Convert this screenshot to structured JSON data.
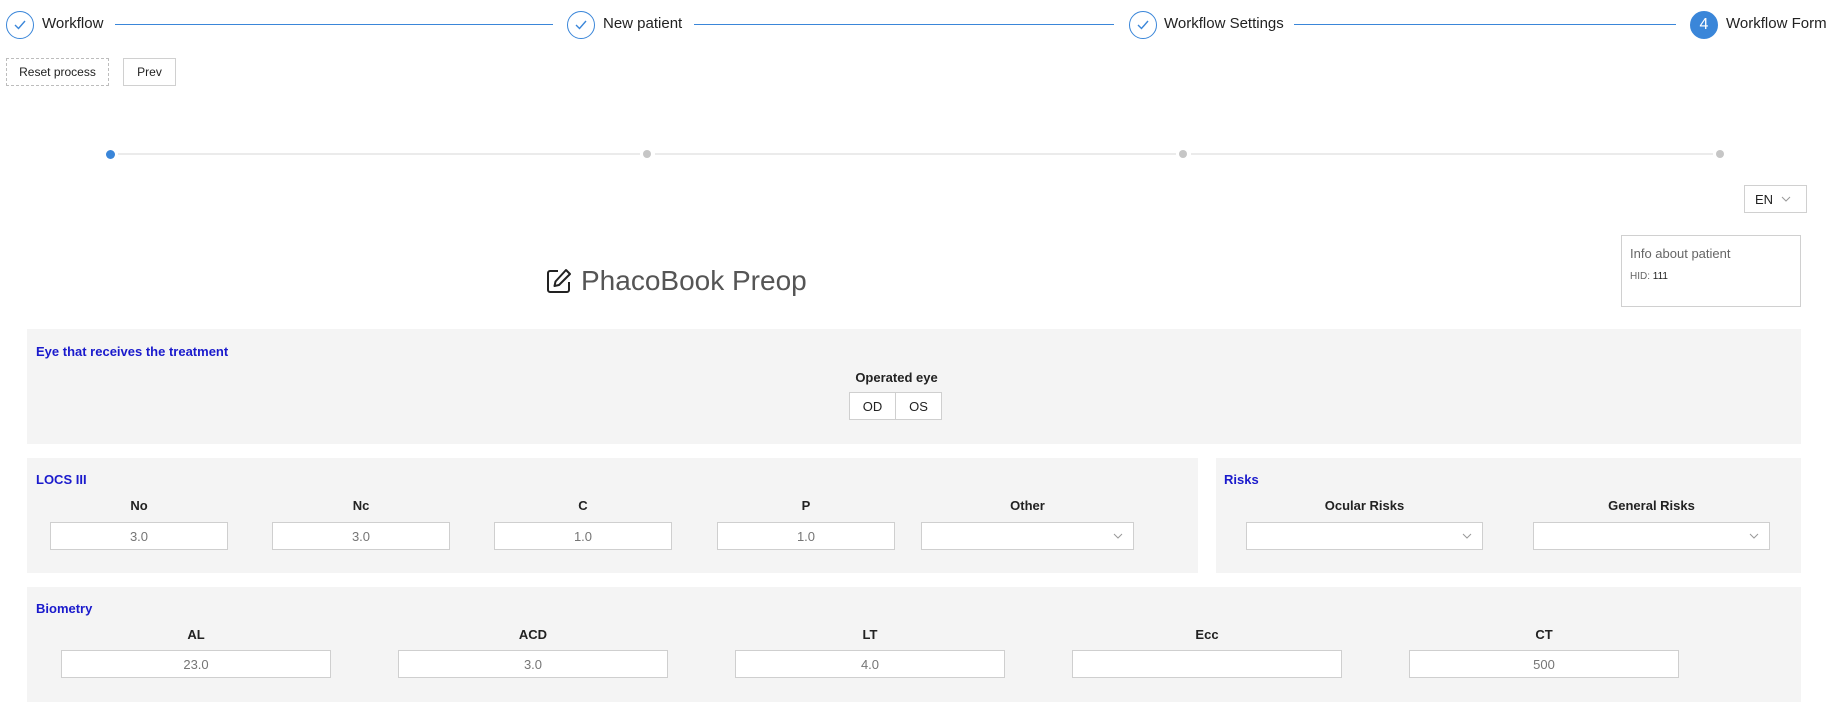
{
  "stepper": {
    "steps": [
      {
        "label": "Workflow",
        "state": "done"
      },
      {
        "label": "New patient",
        "state": "done"
      },
      {
        "label": "Workflow Settings",
        "state": "done"
      },
      {
        "label": "Workflow Form",
        "state": "active",
        "number": "4"
      }
    ]
  },
  "actions": {
    "reset_label": "Reset process",
    "prev_label": "Prev"
  },
  "form_progress": {
    "current_step": 1,
    "total_steps": 4
  },
  "language": {
    "selected": "EN"
  },
  "patient_info": {
    "title": "Info about patient",
    "hid_label": "HID:",
    "hid_value": "111"
  },
  "form": {
    "title": "PhacoBook Preop",
    "eye_section": {
      "title": "Eye that receives the treatment",
      "operated_eye_label": "Operated eye",
      "options": [
        "OD",
        "OS"
      ]
    },
    "locs_section": {
      "title": "LOCS III",
      "fields": [
        {
          "label": "No",
          "placeholder": "3.0"
        },
        {
          "label": "Nc",
          "placeholder": "3.0"
        },
        {
          "label": "C",
          "placeholder": "1.0"
        },
        {
          "label": "P",
          "placeholder": "1.0"
        }
      ],
      "other_label": "Other"
    },
    "risks_section": {
      "title": "Risks",
      "ocular_label": "Ocular Risks",
      "general_label": "General Risks"
    },
    "biometry_section": {
      "title": "Biometry",
      "fields": [
        {
          "label": "AL",
          "placeholder": "23.0"
        },
        {
          "label": "ACD",
          "placeholder": "3.0"
        },
        {
          "label": "LT",
          "placeholder": "4.0"
        },
        {
          "label": "Ecc",
          "placeholder": ""
        },
        {
          "label": "CT",
          "placeholder": "500"
        }
      ]
    }
  },
  "colors": {
    "accent": "#3a86d9",
    "section_title": "#1a1acc",
    "panel_bg": "#f4f4f4"
  }
}
